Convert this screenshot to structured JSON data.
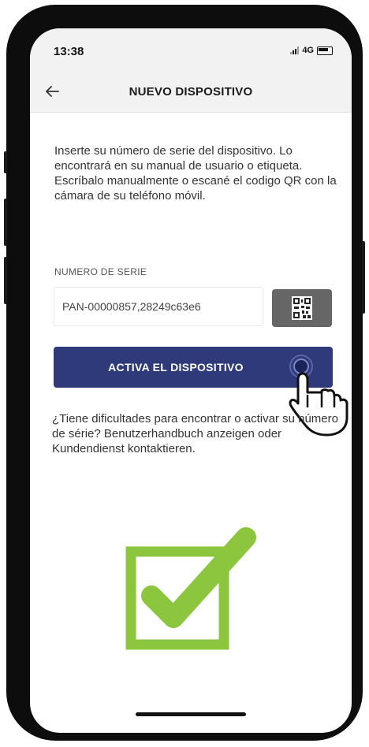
{
  "status_bar": {
    "time": "13:38",
    "network": "4G"
  },
  "header": {
    "title": "NUEVO DISPOSITIVO",
    "back_icon": "arrow-left-icon"
  },
  "instructions": "Inserte su número de serie del dispositivo. Lo encontrará en su manual de usuario o etiqueta. Escríbalo manualmente o escané el codigo QR con la cámara de su teléfono móvil.",
  "serial": {
    "label": "NUMERO DE SERIE",
    "value": "PAN-00000857,28249c63e6"
  },
  "qr_button_icon": "qr-code-icon",
  "activate_button": {
    "label": "ACTIVA EL DISPOSITIVO",
    "color": "#2f3a7a"
  },
  "help_text": "¿Tiene dificultades para encontrar o activar su número de série? Benutzerhandbuch anzeigen oder Kundendienst kontaktieren.",
  "colors": {
    "accent": "#2f3a7a",
    "check_green": "#8cc63f"
  }
}
